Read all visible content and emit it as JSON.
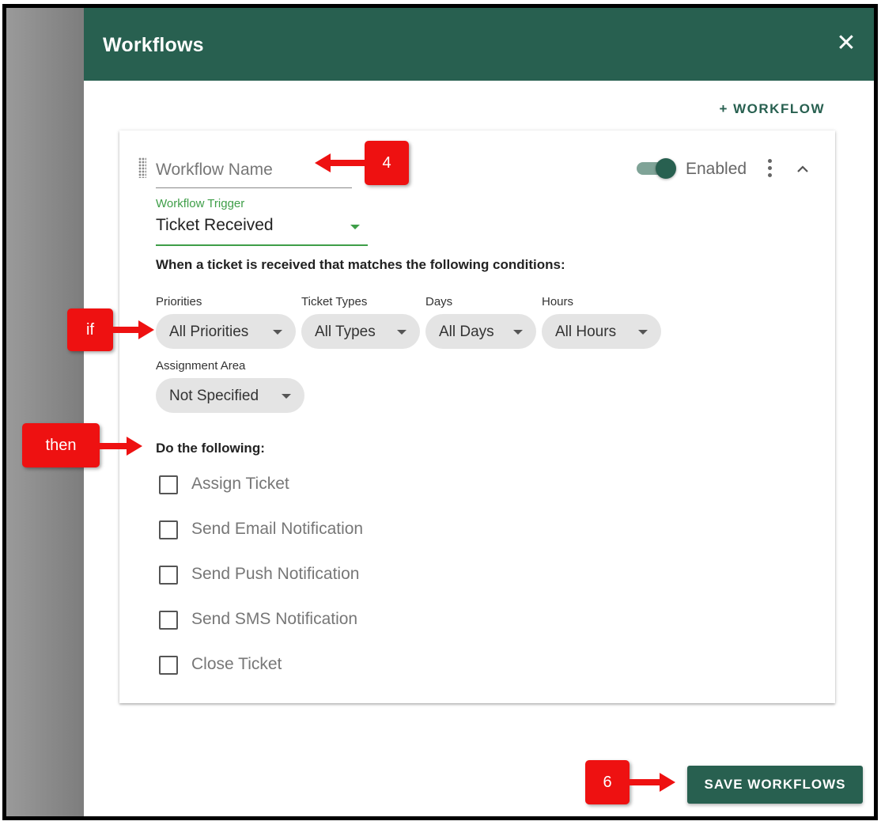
{
  "header": {
    "title": "Workflows",
    "close_label": "✕"
  },
  "add_workflow_label": "+ WORKFLOW",
  "workflow": {
    "name_placeholder": "Workflow Name",
    "enabled_label": "Enabled",
    "enabled": true,
    "trigger_label": "Workflow Trigger",
    "trigger_value": "Ticket Received",
    "conditions_heading": "When a ticket is received that matches the following conditions:",
    "filters": [
      {
        "label": "Priorities",
        "value": "All Priorities"
      },
      {
        "label": "Ticket Types",
        "value": "All Types"
      },
      {
        "label": "Days",
        "value": "All Days"
      },
      {
        "label": "Hours",
        "value": "All Hours"
      },
      {
        "label": "Assignment Area",
        "value": "Not Specified"
      }
    ],
    "actions_heading": "Do the following:",
    "actions": [
      {
        "label": "Assign Ticket",
        "checked": false
      },
      {
        "label": "Send Email Notification",
        "checked": false
      },
      {
        "label": "Send Push Notification",
        "checked": false
      },
      {
        "label": "Send SMS Notification",
        "checked": false
      },
      {
        "label": "Close Ticket",
        "checked": false
      }
    ]
  },
  "save_label": "SAVE WORKFLOWS",
  "annotations": {
    "callout_4": "4",
    "callout_if": "if",
    "callout_then": "then",
    "callout_6": "6"
  },
  "colors": {
    "brand": "#286050",
    "accent_green": "#3e9e48",
    "callout_red": "#ee1111"
  }
}
